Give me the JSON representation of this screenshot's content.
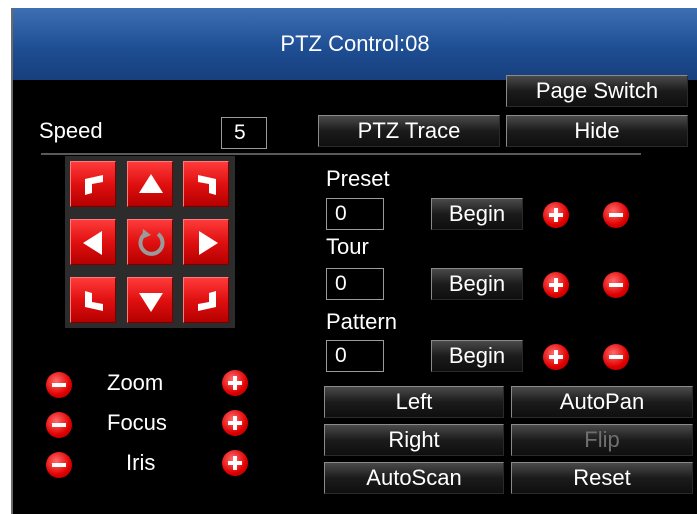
{
  "window": {
    "title": "PTZ Control:08"
  },
  "top": {
    "page_switch": "Page Switch",
    "ptz_trace": "PTZ Trace",
    "hide": "Hide"
  },
  "speed": {
    "label": "Speed",
    "value": "5"
  },
  "preset": {
    "label": "Preset",
    "value": "0",
    "begin": "Begin"
  },
  "tour": {
    "label": "Tour",
    "value": "0",
    "begin": "Begin"
  },
  "pattern": {
    "label": "Pattern",
    "value": "0",
    "begin": "Begin"
  },
  "lens": {
    "zoom": "Zoom",
    "focus": "Focus",
    "iris": "Iris"
  },
  "actions": {
    "left": "Left",
    "autopan": "AutoPan",
    "right": "Right",
    "flip": "Flip",
    "autoscan": "AutoScan",
    "reset": "Reset"
  },
  "icons": [
    "arrow-up-left-icon",
    "arrow-up-icon",
    "arrow-up-right-icon",
    "arrow-left-icon",
    "rotate-icon",
    "arrow-right-icon",
    "arrow-down-left-icon",
    "arrow-down-icon",
    "arrow-down-right-icon",
    "plus-icon",
    "minus-icon"
  ],
  "colors": {
    "title_bar": "#1e4e94",
    "button_red": "#e01010",
    "background": "#000000"
  }
}
